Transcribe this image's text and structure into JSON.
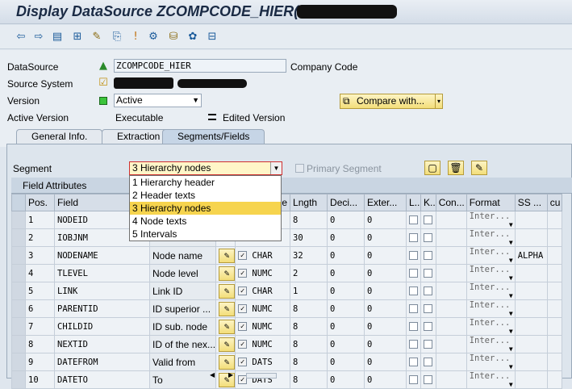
{
  "window": {
    "title": "Display DataSource ZCOMPCODE_HIER("
  },
  "toolbar": {
    "icons": [
      "back-icon",
      "forward-icon",
      "list-icon",
      "hierarchy-icon",
      "wand-icon",
      "display-icon",
      "info-icon",
      "settings-icon",
      "db-icon",
      "gear-icon",
      "tree-icon"
    ]
  },
  "header": {
    "datasource_label": "DataSource",
    "datasource_value": "ZCOMPCODE_HIER",
    "datasource_desc": "Company Code",
    "source_system_label": "Source System",
    "version_label": "Version",
    "version_value": "Active",
    "compare_button": "Compare with...",
    "active_version_label": "Active Version",
    "active_version_value": "Executable",
    "edited_version_value": "Edited Version"
  },
  "tabs": [
    {
      "label": "General Info."
    },
    {
      "label": "Extraction"
    },
    {
      "label": "Segments/Fields"
    }
  ],
  "segment": {
    "label": "Segment",
    "selected": "3 Hierarchy nodes",
    "primary_label": "Primary Segment",
    "options": [
      "1 Hierarchy header",
      "2 Header texts",
      "3 Hierarchy nodes",
      "4 Node texts",
      "5 Intervals"
    ]
  },
  "grid": {
    "title": "Field Attributes",
    "columns": [
      "Pos.",
      "Field",
      "",
      "",
      "e",
      "Lngth",
      "Deci...",
      "Exter...",
      "L..",
      "K..",
      "Con...",
      "Format",
      "SS ...",
      "cu"
    ],
    "rows": [
      {
        "pos": "1",
        "field": "NODEID",
        "desc": "",
        "type": "",
        "len": "8",
        "dec": "0",
        "ext": "0",
        "format": "Inter...",
        "ss": ""
      },
      {
        "pos": "2",
        "field": "IOBJNM",
        "desc": "",
        "type": "",
        "len": "30",
        "dec": "0",
        "ext": "0",
        "format": "Inter...",
        "ss": ""
      },
      {
        "pos": "3",
        "field": "NODENAME",
        "desc": "Node name",
        "type": "CHAR",
        "len": "32",
        "dec": "0",
        "ext": "0",
        "format": "Inter...",
        "ss": "ALPHA"
      },
      {
        "pos": "4",
        "field": "TLEVEL",
        "desc": "Node level",
        "type": "NUMC",
        "len": "2",
        "dec": "0",
        "ext": "0",
        "format": "Inter...",
        "ss": ""
      },
      {
        "pos": "5",
        "field": "LINK",
        "desc": "Link ID",
        "type": "CHAR",
        "len": "1",
        "dec": "0",
        "ext": "0",
        "format": "Inter...",
        "ss": ""
      },
      {
        "pos": "6",
        "field": "PARENTID",
        "desc": "ID superior ...",
        "type": "NUMC",
        "len": "8",
        "dec": "0",
        "ext": "0",
        "format": "Inter...",
        "ss": ""
      },
      {
        "pos": "7",
        "field": "CHILDID",
        "desc": "ID sub. node",
        "type": "NUMC",
        "len": "8",
        "dec": "0",
        "ext": "0",
        "format": "Inter...",
        "ss": ""
      },
      {
        "pos": "8",
        "field": "NEXTID",
        "desc": "ID of the nex...",
        "type": "NUMC",
        "len": "8",
        "dec": "0",
        "ext": "0",
        "format": "Inter...",
        "ss": ""
      },
      {
        "pos": "9",
        "field": "DATEFROM",
        "desc": "Valid from",
        "type": "DATS",
        "len": "8",
        "dec": "0",
        "ext": "0",
        "format": "Inter...",
        "ss": ""
      },
      {
        "pos": "10",
        "field": "DATETO",
        "desc": "To",
        "type": "DATS",
        "len": "8",
        "dec": "0",
        "ext": "0",
        "format": "Inter...",
        "ss": ""
      }
    ]
  }
}
